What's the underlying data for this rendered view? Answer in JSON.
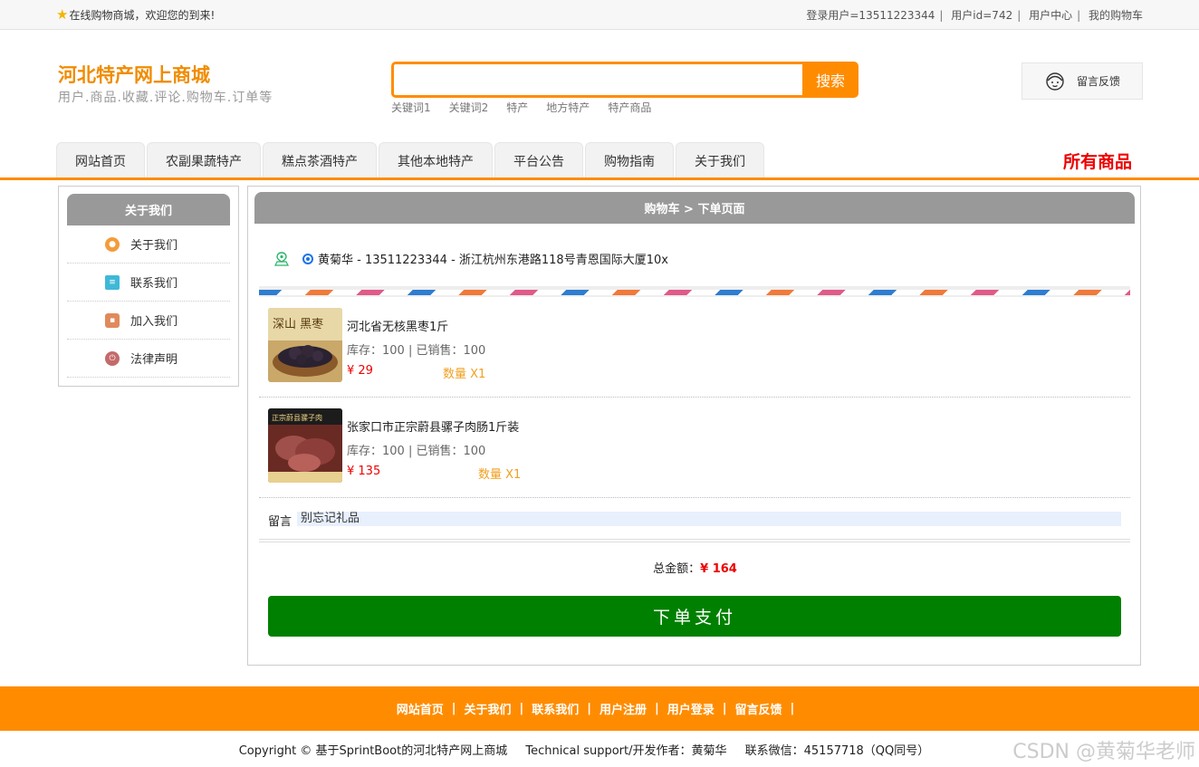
{
  "topbar": {
    "welcome": "在线购物商城，欢迎您的到来!",
    "links": [
      "登录用户=13511223344",
      "用户id=742",
      "用户中心",
      "我的购物车"
    ]
  },
  "brand": {
    "title": "河北特产网上商城",
    "subtitle": "用户.商品.收藏.评论.购物车.订单等"
  },
  "search": {
    "value": "",
    "button": "搜索",
    "keywords": [
      "关键词1",
      "关键词2",
      "特产",
      "地方特产",
      "特产商品"
    ]
  },
  "feedback": "留言反馈",
  "nav": {
    "tabs": [
      "网站首页",
      "农副果蔬特产",
      "糕点茶酒特产",
      "其他本地特产",
      "平台公告",
      "购物指南",
      "关于我们"
    ],
    "all_goods": "所有商品"
  },
  "sidebar": {
    "title": "关于我们",
    "items": [
      {
        "label": "关于我们",
        "icon": "info-icon",
        "color": "#f39c3c"
      },
      {
        "label": "联系我们",
        "icon": "clipboard-icon",
        "color": "#3fb8d8"
      },
      {
        "label": "加入我们",
        "icon": "lock-icon",
        "color": "#e08a5c"
      },
      {
        "label": "法律声明",
        "icon": "power-icon",
        "color": "#c46a6a"
      }
    ]
  },
  "checkout": {
    "breadcrumb": "购物车 > 下单页面",
    "address": "黄菊华 - 13511223344 - 浙江杭州东港路118号青恩国际大厦10x",
    "items": [
      {
        "name": "河北省无核黑枣1斤",
        "stock": "库存：100 | 已销售：100",
        "price": "¥ 29",
        "qty": "数量 X1",
        "image_text": "深山 黑枣"
      },
      {
        "name": "张家口市正宗蔚县骡子肉肠1斤装",
        "stock": "库存：100 | 已销售：100",
        "price": "¥ 135",
        "qty": "数量 X1",
        "image_text": "正宗蔚县骡子肉"
      }
    ],
    "remark_label": "留言",
    "remark_value": "别忘记礼品",
    "total_label": "总金额：",
    "total_value": "¥ 164",
    "pay_button": "下单支付"
  },
  "footer": {
    "links": [
      "网站首页",
      "关于我们",
      "联系我们",
      "用户注册",
      "用户登录",
      "留言反馈"
    ],
    "copyright": [
      "Copyright © 基于SprintBoot的河北特产网上商城",
      "Technical support/开发作者：黄菊华",
      "联系微信：45157718（QQ同号）"
    ],
    "watermark": "CSDN @黄菊华老师"
  }
}
